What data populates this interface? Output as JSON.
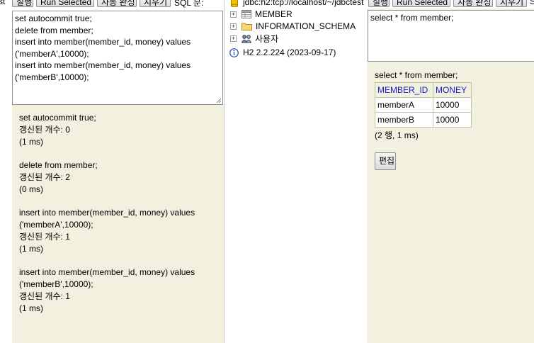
{
  "left": {
    "toolbar": {
      "cut_text": "st",
      "run_label": "실행",
      "run_selected_label": "Run Selected",
      "auto_complete_label": "자동 완성",
      "clear_label": "지우기",
      "sql_label": "SQL 문:"
    },
    "sql_editor": {
      "lines": [
        "set autocommit true;",
        "delete from member;",
        "insert into member(member_id, money) values",
        "('memberA',10000);",
        "insert into member(member_id, money) values",
        "('memberB',10000);"
      ]
    },
    "results": [
      "set autocommit true;",
      "갱신된 개수: 0",
      "(1 ms)",
      "",
      "delete from member;",
      "갱신된 개수: 2",
      "(0 ms)",
      "",
      "insert into member(member_id, money) values",
      "('memberA',10000);",
      "갱신된 개수: 1",
      "(1 ms)",
      "",
      "insert into member(member_id, money) values",
      "('memberB',10000);",
      "갱신된 개수: 1",
      "(1 ms)"
    ]
  },
  "tree": {
    "connection": "jdbc:h2:tcp://localhost/~/jdbctest",
    "items": [
      {
        "label": "MEMBER",
        "icon": "table-icon"
      },
      {
        "label": "INFORMATION_SCHEMA",
        "icon": "folder-icon"
      },
      {
        "label": "사용자",
        "icon": "users-icon"
      }
    ],
    "version": "H2 2.2.224 (2023-09-17)"
  },
  "right": {
    "toolbar": {
      "run_label": "실행",
      "run_selected_label": "Run Selected",
      "auto_complete_label": "자동 완성",
      "clear_label": "지우기",
      "cut_text": "S"
    },
    "sql_editor_text": "select * from member;",
    "result_query": "select * from member;",
    "columns": [
      "MEMBER_ID",
      "MONEY"
    ],
    "rows": [
      [
        "memberA",
        "10000"
      ],
      [
        "memberB",
        "10000"
      ]
    ],
    "summary": "(2 행, 1 ms)",
    "edit_label": "편집"
  },
  "colors": {
    "result_bg": "#f2f0de",
    "header_link": "#1a1acc"
  }
}
